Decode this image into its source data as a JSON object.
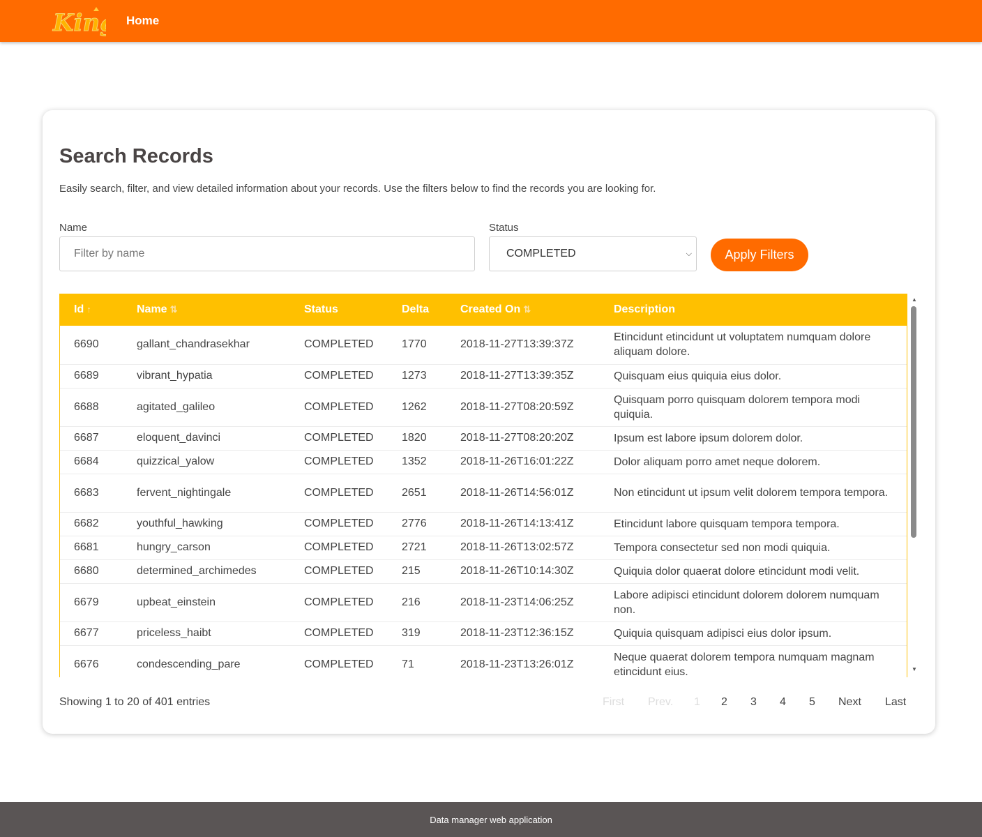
{
  "header": {
    "logo_text": "King",
    "nav_home": "Home",
    "brand_color": "#ff6b00"
  },
  "card": {
    "title": "Search Records",
    "subtitle": "Easily search, filter, and view detailed information about your records. Use the filters below to find the records you are looking for."
  },
  "filters": {
    "name_label": "Name",
    "name_placeholder": "Filter by name",
    "name_value": "",
    "status_label": "Status",
    "status_value": "COMPLETED",
    "apply_label": "Apply Filters"
  },
  "table": {
    "header_color": "#ffc000",
    "columns": [
      {
        "label": "Id",
        "sort": "asc"
      },
      {
        "label": "Name",
        "sort": "both"
      },
      {
        "label": "Status",
        "sort": "none"
      },
      {
        "label": "Delta",
        "sort": "none"
      },
      {
        "label": "Created On",
        "sort": "both"
      },
      {
        "label": "Description",
        "sort": "none"
      }
    ],
    "rows": [
      {
        "id": "6690",
        "name": "gallant_chandrasekhar",
        "status": "COMPLETED",
        "delta": "1770",
        "created": "2018-11-27T13:39:37Z",
        "description": "Etincidunt etincidunt ut voluptatem numquam dolore aliquam dolore."
      },
      {
        "id": "6689",
        "name": "vibrant_hypatia",
        "status": "COMPLETED",
        "delta": "1273",
        "created": "2018-11-27T13:39:35Z",
        "description": "Quisquam eius quiquia eius dolor."
      },
      {
        "id": "6688",
        "name": "agitated_galileo",
        "status": "COMPLETED",
        "delta": "1262",
        "created": "2018-11-27T08:20:59Z",
        "description": "Quisquam porro quisquam dolorem tempora modi quiquia."
      },
      {
        "id": "6687",
        "name": "eloquent_davinci",
        "status": "COMPLETED",
        "delta": "1820",
        "created": "2018-11-27T08:20:20Z",
        "description": "Ipsum est labore ipsum dolorem dolor."
      },
      {
        "id": "6684",
        "name": "quizzical_yalow",
        "status": "COMPLETED",
        "delta": "1352",
        "created": "2018-11-26T16:01:22Z",
        "description": "Dolor aliquam porro amet neque dolorem."
      },
      {
        "id": "6683",
        "name": "fervent_nightingale",
        "status": "COMPLETED",
        "delta": "2651",
        "created": "2018-11-26T14:56:01Z",
        "description": "Non etincidunt ut ipsum velit dolorem tempora tempora."
      },
      {
        "id": "6682",
        "name": "youthful_hawking",
        "status": "COMPLETED",
        "delta": "2776",
        "created": "2018-11-26T14:13:41Z",
        "description": "Etincidunt labore quisquam tempora tempora."
      },
      {
        "id": "6681",
        "name": "hungry_carson",
        "status": "COMPLETED",
        "delta": "2721",
        "created": "2018-11-26T13:02:57Z",
        "description": "Tempora consectetur sed non modi quiquia."
      },
      {
        "id": "6680",
        "name": "determined_archimedes",
        "status": "COMPLETED",
        "delta": "215",
        "created": "2018-11-26T10:14:30Z",
        "description": "Quiquia dolor quaerat dolore etincidunt modi velit."
      },
      {
        "id": "6679",
        "name": "upbeat_einstein",
        "status": "COMPLETED",
        "delta": "216",
        "created": "2018-11-23T14:06:25Z",
        "description": "Labore adipisci etincidunt dolorem dolorem numquam non."
      },
      {
        "id": "6677",
        "name": "priceless_haibt",
        "status": "COMPLETED",
        "delta": "319",
        "created": "2018-11-23T12:36:15Z",
        "description": "Quiquia quisquam adipisci eius dolor ipsum."
      },
      {
        "id": "6676",
        "name": "condescending_pare",
        "status": "COMPLETED",
        "delta": "71",
        "created": "2018-11-23T13:26:01Z",
        "description": "Neque quaerat dolorem tempora numquam magnam etincidunt eius."
      }
    ]
  },
  "pagination": {
    "info": "Showing 1 to 20 of 401 entries",
    "first": "First",
    "prev": "Prev.",
    "pages": [
      "1",
      "2",
      "3",
      "4",
      "5"
    ],
    "current_page": "1",
    "next": "Next",
    "last": "Last"
  },
  "footer": {
    "text": "Data manager web application"
  }
}
